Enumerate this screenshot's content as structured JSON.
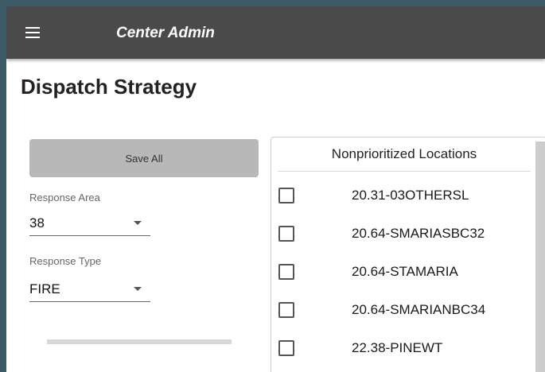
{
  "header": {
    "title": "Center Admin"
  },
  "page": {
    "title": "Dispatch Strategy"
  },
  "actions": {
    "save_all_label": "Save All"
  },
  "filters": {
    "response_area": {
      "label": "Response Area",
      "value": "38"
    },
    "response_type": {
      "label": "Response Type",
      "value": "FIRE"
    }
  },
  "nonprioritized": {
    "header": "Nonprioritized Locations",
    "items": [
      {
        "label": "20.31-03OTHERSL",
        "checked": false
      },
      {
        "label": "20.64-SMARIASBC32",
        "checked": false
      },
      {
        "label": "20.64-STAMARIA",
        "checked": false
      },
      {
        "label": "20.64-SMARIANBC34",
        "checked": false
      },
      {
        "label": "22.38-PINEWT",
        "checked": false
      }
    ]
  },
  "icons": {
    "menu": "hamburger-menu-icon",
    "dropdown": "caret-down-icon"
  },
  "colors": {
    "appbar": "#4a4a4a",
    "save_button": "#b8b8b8",
    "frame_border": "#3b5b66"
  }
}
